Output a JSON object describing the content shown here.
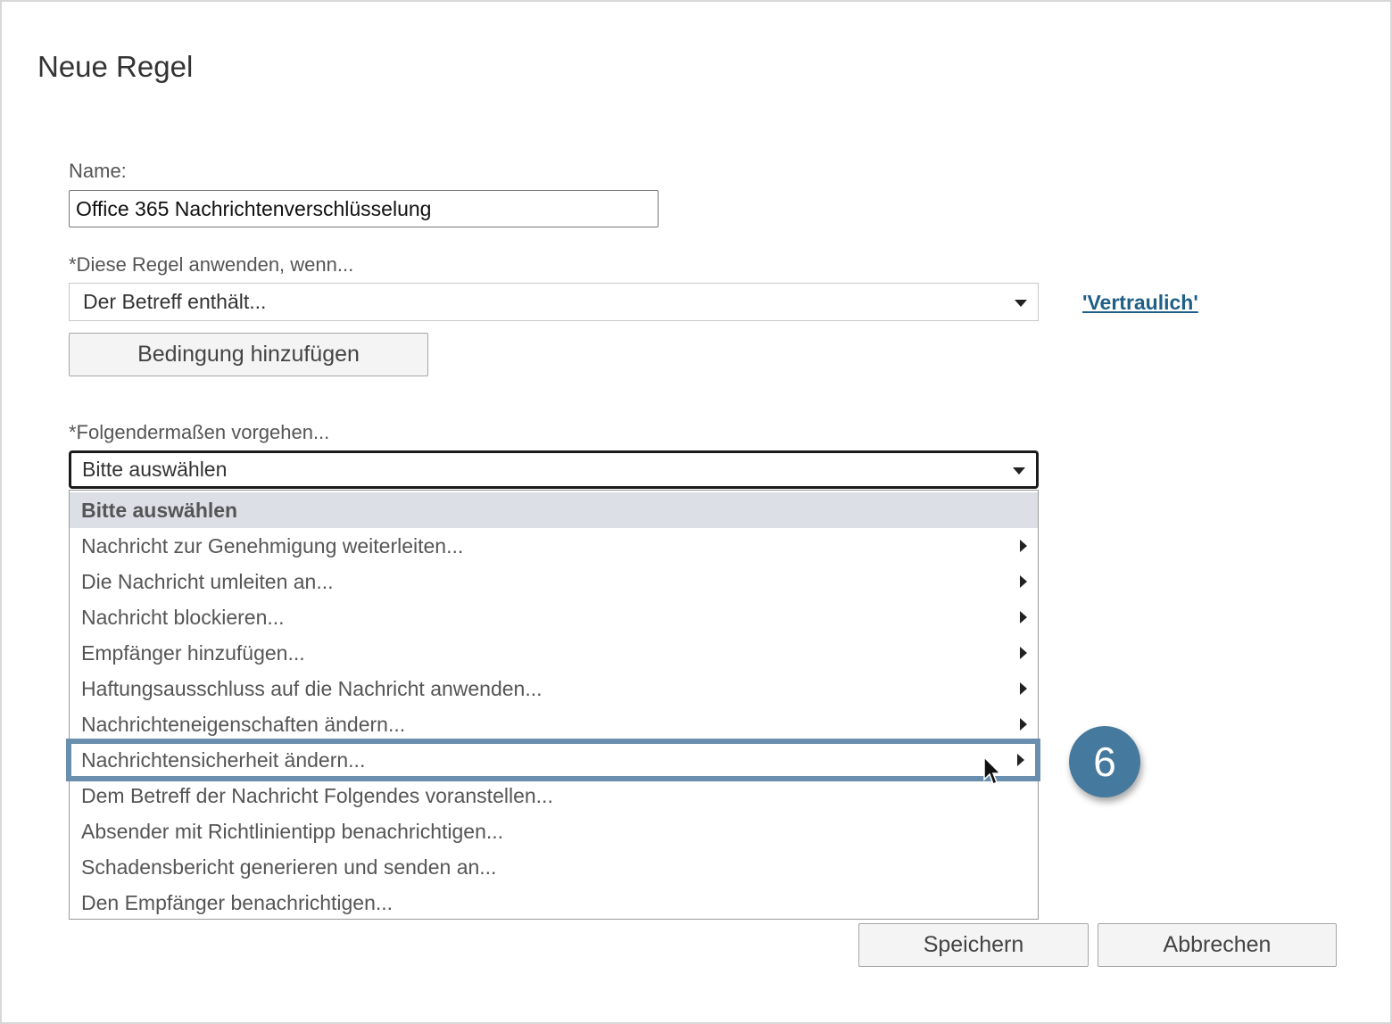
{
  "dialog": {
    "title": "Neue Regel"
  },
  "name_field": {
    "label": "Name:",
    "value": "Office 365 Nachrichtenverschlüsselung"
  },
  "condition": {
    "label": "*Diese Regel anwenden, wenn...",
    "selected": "Der Betreff enthält...",
    "value_link": "'Vertraulich'",
    "add_button": "Bedingung hinzufügen"
  },
  "action": {
    "label": "*Folgendermaßen vorgehen...",
    "selected": "Bitte auswählen",
    "options": [
      {
        "label": "Bitte auswählen"
      },
      {
        "label": "Nachricht zur Genehmigung weiterleiten..."
      },
      {
        "label": "Die Nachricht umleiten an..."
      },
      {
        "label": "Nachricht blockieren..."
      },
      {
        "label": "Empfänger hinzufügen..."
      },
      {
        "label": "Haftungsausschluss auf die Nachricht anwenden..."
      },
      {
        "label": "Nachrichteneigenschaften ändern..."
      },
      {
        "label": "Nachrichtensicherheit ändern..."
      },
      {
        "label": "Dem Betreff der Nachricht Folgendes voranstellen..."
      },
      {
        "label": "Absender mit Richtlinientipp benachrichtigen..."
      },
      {
        "label": "Schadensbericht generieren und senden an..."
      },
      {
        "label": "Den Empfänger benachrichtigen..."
      }
    ]
  },
  "footer": {
    "save": "Speichern",
    "cancel": "Abbrechen"
  },
  "step_badge": "6",
  "colors": {
    "highlight": "#6a8fae",
    "badge": "#46799e",
    "link": "#1f5f86",
    "header_row": "#dcdfe6"
  }
}
